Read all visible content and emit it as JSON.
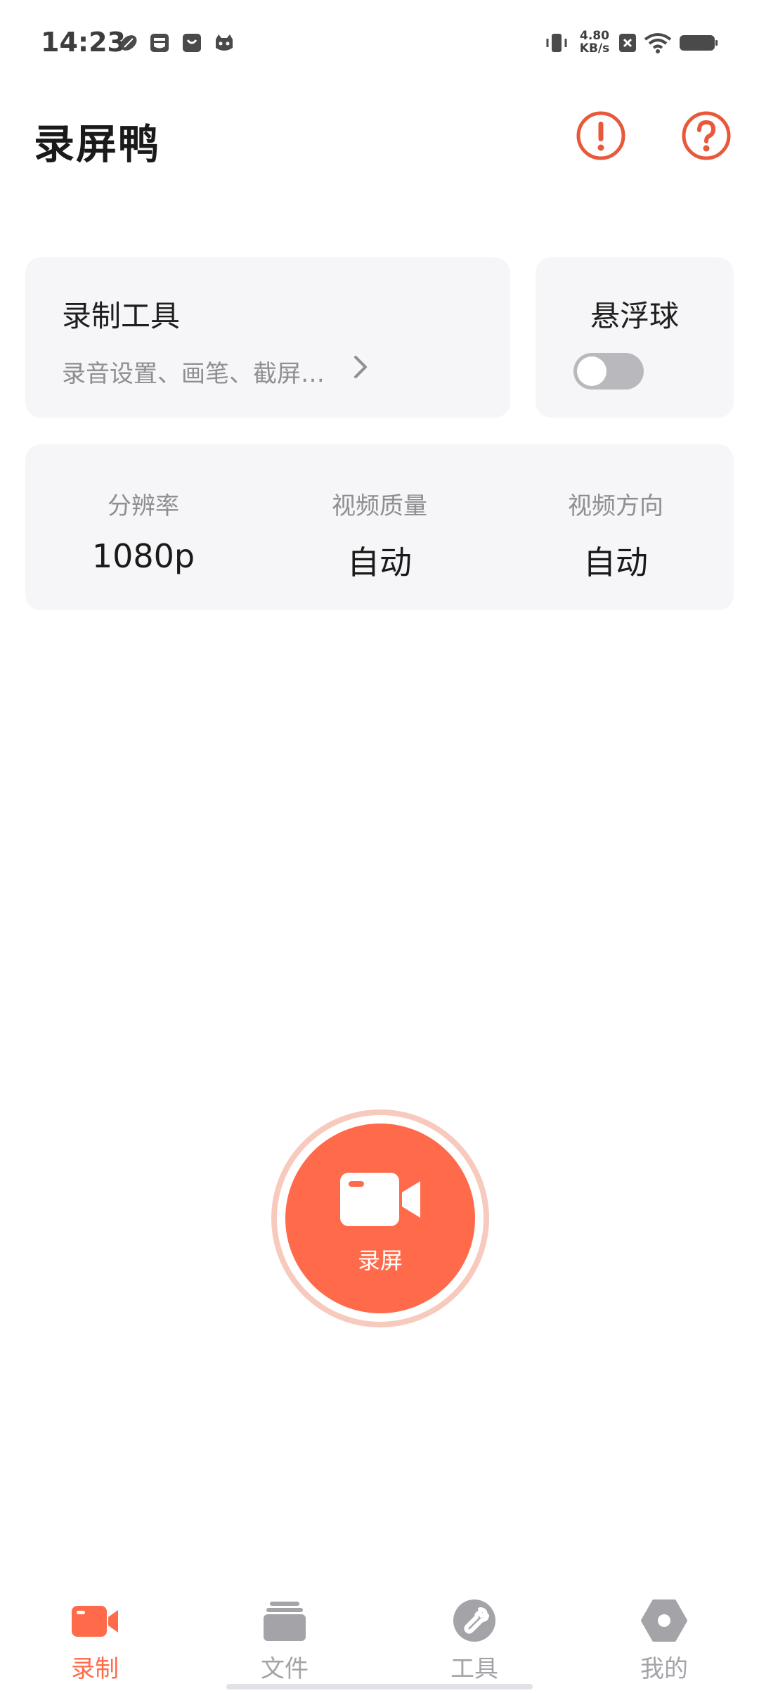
{
  "status_bar": {
    "time": "14:23",
    "net_speed_value": "4.80",
    "net_speed_unit": "KB/s",
    "notification_icons": [
      "rugby-ball-icon",
      "inbox-icon",
      "shopping-bag-icon",
      "cat-face-icon"
    ],
    "system_icons": [
      "vibrate-icon",
      "sim-off-icon",
      "wifi-icon",
      "battery-icon"
    ]
  },
  "header": {
    "title": "录屏鸭",
    "actions": [
      "info-icon",
      "help-icon"
    ]
  },
  "tools_card": {
    "title": "录制工具",
    "subtitle": "录音设置、画笔、截屏…"
  },
  "float_ball": {
    "title": "悬浮球",
    "enabled": false
  },
  "settings": [
    {
      "label": "分辨率",
      "value": "1080p"
    },
    {
      "label": "视频质量",
      "value": "自动"
    },
    {
      "label": "视频方向",
      "value": "自动"
    }
  ],
  "record_button": {
    "label": "录屏"
  },
  "bottom_nav": [
    {
      "label": "录制",
      "icon": "video-camera-icon",
      "active": true
    },
    {
      "label": "文件",
      "icon": "files-stack-icon",
      "active": false
    },
    {
      "label": "工具",
      "icon": "wrench-icon",
      "active": false
    },
    {
      "label": "我的",
      "icon": "hexagon-profile-icon",
      "active": false
    }
  ],
  "colors": {
    "accent": "#ff6b4a",
    "accent_ring": "#f8c9bd",
    "card_bg": "#f6f6f8",
    "muted_text": "#8e8e93",
    "inactive_icon": "#a3a3a8"
  }
}
